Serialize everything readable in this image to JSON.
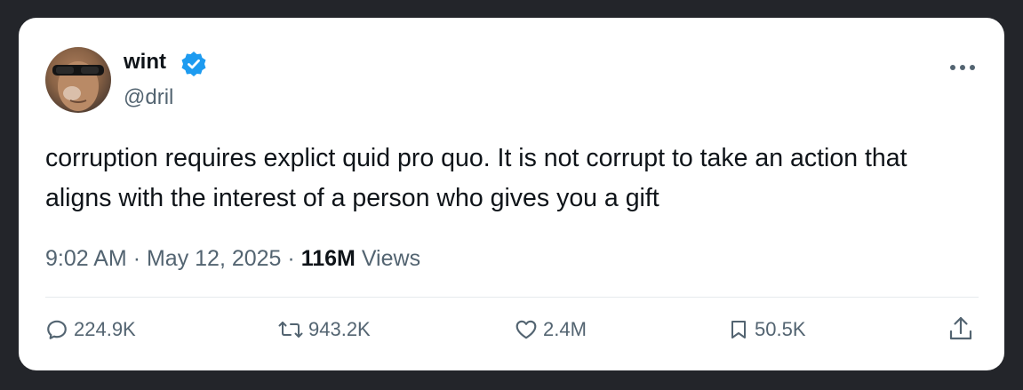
{
  "tweet": {
    "author": {
      "display_name": "wint",
      "handle": "@dril",
      "verified": true
    },
    "text": "corruption requires explict quid pro quo. It is not corrupt to take an action that aligns with the interest of a person who gives you a gift",
    "time": "9:02 AM",
    "date": "May 12, 2025",
    "separator": "·",
    "views_count": "116M",
    "views_label": "Views"
  },
  "actions": {
    "replies": "224.9K",
    "reposts": "943.2K",
    "likes": "2.4M",
    "bookmarks": "50.5K"
  },
  "icons": {
    "verified": "verified-badge-icon",
    "more": "more-options-icon",
    "reply": "reply-icon",
    "repost": "repost-icon",
    "like": "heart-icon",
    "bookmark": "bookmark-icon",
    "share": "share-icon"
  },
  "colors": {
    "background": "#23252a",
    "card": "#ffffff",
    "primary_text": "#0f1419",
    "secondary_text": "#536471",
    "verified_blue": "#1d9bf0"
  }
}
